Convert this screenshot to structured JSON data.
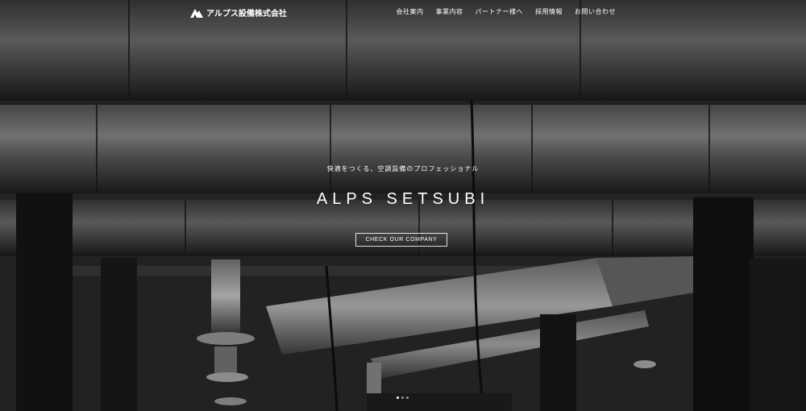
{
  "brand": {
    "logo_text": "アルプス設備株式会社"
  },
  "nav": {
    "items": [
      {
        "label": "会社案内"
      },
      {
        "label": "事業内容"
      },
      {
        "label": "パートナー様へ"
      },
      {
        "label": "採用情報"
      },
      {
        "label": "お問い合わせ"
      }
    ]
  },
  "hero": {
    "tagline": "快適をつくる、空調設備のプロフェッショナル",
    "title": "ALPS SETSUBI",
    "cta_label": "CHECK OUR COMPANY",
    "slide_count": 3,
    "active_slide": 1
  },
  "colors": {
    "text": "#ffffff",
    "background": "#1a1a1a"
  }
}
